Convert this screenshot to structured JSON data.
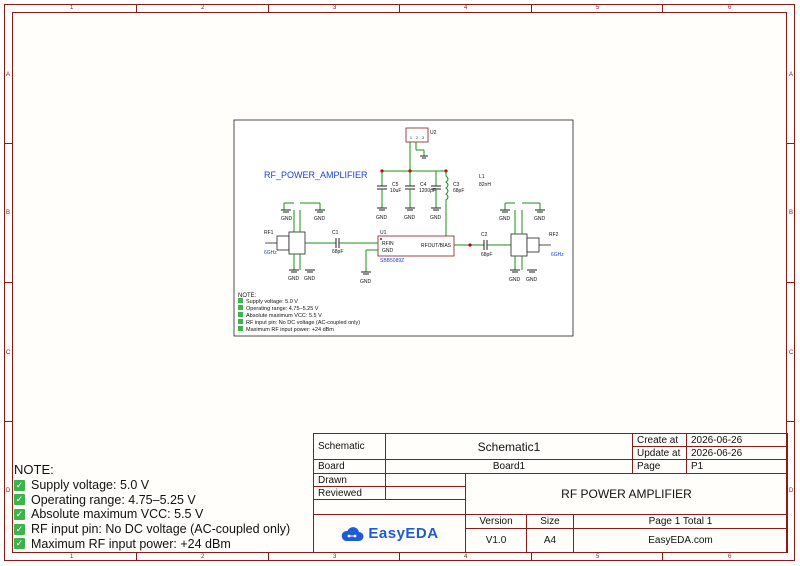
{
  "sheet": {
    "col_labels": [
      "1",
      "2",
      "3",
      "4",
      "5",
      "6"
    ],
    "row_labels": [
      "A",
      "B",
      "C",
      "D"
    ]
  },
  "schematic": {
    "title": "RF_POWER_AMPLIFIER",
    "components": {
      "rf1": {
        "ref": "RF1",
        "value": "6GHz"
      },
      "rf2": {
        "ref": "RF2",
        "value": "6GHz"
      },
      "c1": {
        "ref": "C1",
        "value": "68pF"
      },
      "c2": {
        "ref": "C2",
        "value": "68pF"
      },
      "c3": {
        "ref": "C3",
        "value": "68pF"
      },
      "c4": {
        "ref": "C4",
        "value": "1200pF"
      },
      "c5": {
        "ref": "C5",
        "value": "10uF"
      },
      "l1": {
        "ref": "L1",
        "value": "82nH"
      },
      "u1": {
        "ref": "U1",
        "part": "SBB5089Z",
        "pin_in": "RFIN",
        "pin_gnd": "GND",
        "pin_out": "RFOUT/BIAS"
      },
      "u2": {
        "ref": "U2"
      }
    },
    "gnd_label": "GND",
    "pin_numbers": {
      "one": "1",
      "two": "2",
      "three": "3",
      "four": "4",
      "five": "5"
    },
    "notes": {
      "title": "NOTE:",
      "items": [
        "Supply voltage: 5.0 V",
        "Operating range: 4.75–5.25 V",
        "Absolute maximum VCC: 5.5 V",
        "RF input pin: No DC voltage (AC-coupled only)",
        "Maximum RF input power: +24 dBm"
      ]
    }
  },
  "big_notes": {
    "title": "NOTE:",
    "items": [
      "Supply voltage: 5.0 V",
      "Operating range: 4.75–5.25 V",
      "Absolute maximum VCC: 5.5 V",
      "RF input pin: No DC voltage (AC-coupled only)",
      "Maximum RF input power: +24 dBm"
    ]
  },
  "title_block": {
    "schematic_label": "Schematic",
    "schematic_name": "Schematic1",
    "create_at_label": "Create at",
    "create_at_value": "2026-06-26",
    "update_at_label": "Update at",
    "update_at_value": "2026-06-26",
    "board_label": "Board",
    "board_name": "Board1",
    "page_label": "Page",
    "page_value": "P1",
    "drawn_label": "Drawn",
    "reviewed_label": "Reviewed",
    "title": "RF POWER AMPLIFIER",
    "version_label": "Version",
    "version_value": "V1.0",
    "size_label": "Size",
    "size_value": "A4",
    "page_total": "Page  1  Total  1",
    "site": "EasyEDA.com",
    "logo_text": "EasyEDA"
  },
  "colors": {
    "border": "#8b1a1a",
    "wire": "#1a8f1a",
    "label_blue": "#1e3fd8",
    "check_green": "#3cb44b",
    "logo_blue": "#1e5bd8"
  }
}
